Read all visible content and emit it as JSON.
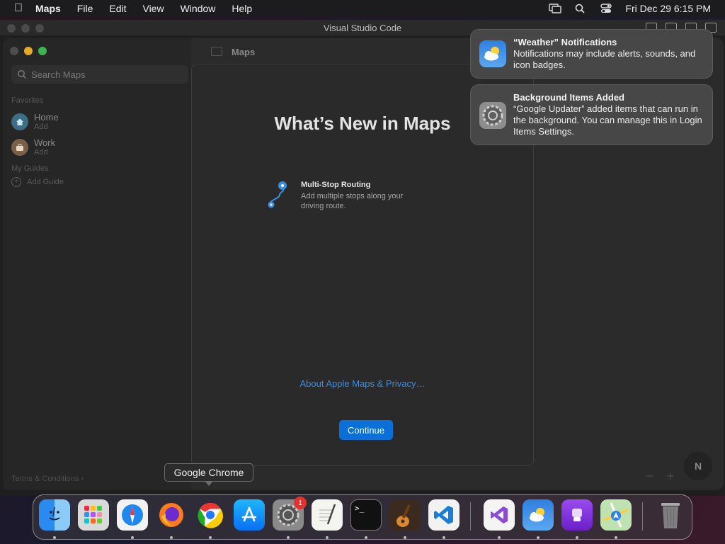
{
  "menubar": {
    "app": "Maps",
    "items": [
      "File",
      "Edit",
      "View",
      "Window",
      "Help"
    ],
    "clock": "Fri Dec 29  6:15 PM"
  },
  "vscode": {
    "title": "Visual Studio Code"
  },
  "maps": {
    "toolbar_title": "Maps",
    "search_placeholder": "Search Maps",
    "favorites_label": "Favorites",
    "favorites": [
      {
        "name": "Home",
        "sub": "Add",
        "color": "#3c6f85"
      },
      {
        "name": "Work",
        "sub": "Add",
        "color": "#7a6048"
      }
    ],
    "guides_label": "My Guides",
    "add_guide": "Add Guide",
    "terms": "Terms & Conditions",
    "compass": "N",
    "zoom_out": "−",
    "zoom_in": "+"
  },
  "sheet": {
    "title": "What’s New in Maps",
    "feature_title": "Multi-Stop Routing",
    "feature_desc": "Add multiple stops along your driving route.",
    "privacy_link": "About Apple Maps & Privacy…",
    "continue": "Continue"
  },
  "notifications": [
    {
      "title": "“Weather” Notifications",
      "body": "Notifications may include alerts, sounds, and icon badges."
    },
    {
      "title": "Background Items Added",
      "body": "“Google Updater” added items that can run in the background. You can manage this in Login Items Settings."
    }
  ],
  "tooltip": "Google Chrome",
  "dock": {
    "apps": [
      "finder-icon",
      "launchpad-icon",
      "safari-icon",
      "firefox-icon",
      "chrome-icon",
      "app-store-icon",
      "system-settings-icon",
      "textedit-icon",
      "terminal-icon",
      "garageband-icon",
      "vscode-icon",
      "visual-studio-icon",
      "weather-icon",
      "podcasts-icon",
      "maps-icon",
      "trash-icon"
    ],
    "settings_badge": "1"
  }
}
